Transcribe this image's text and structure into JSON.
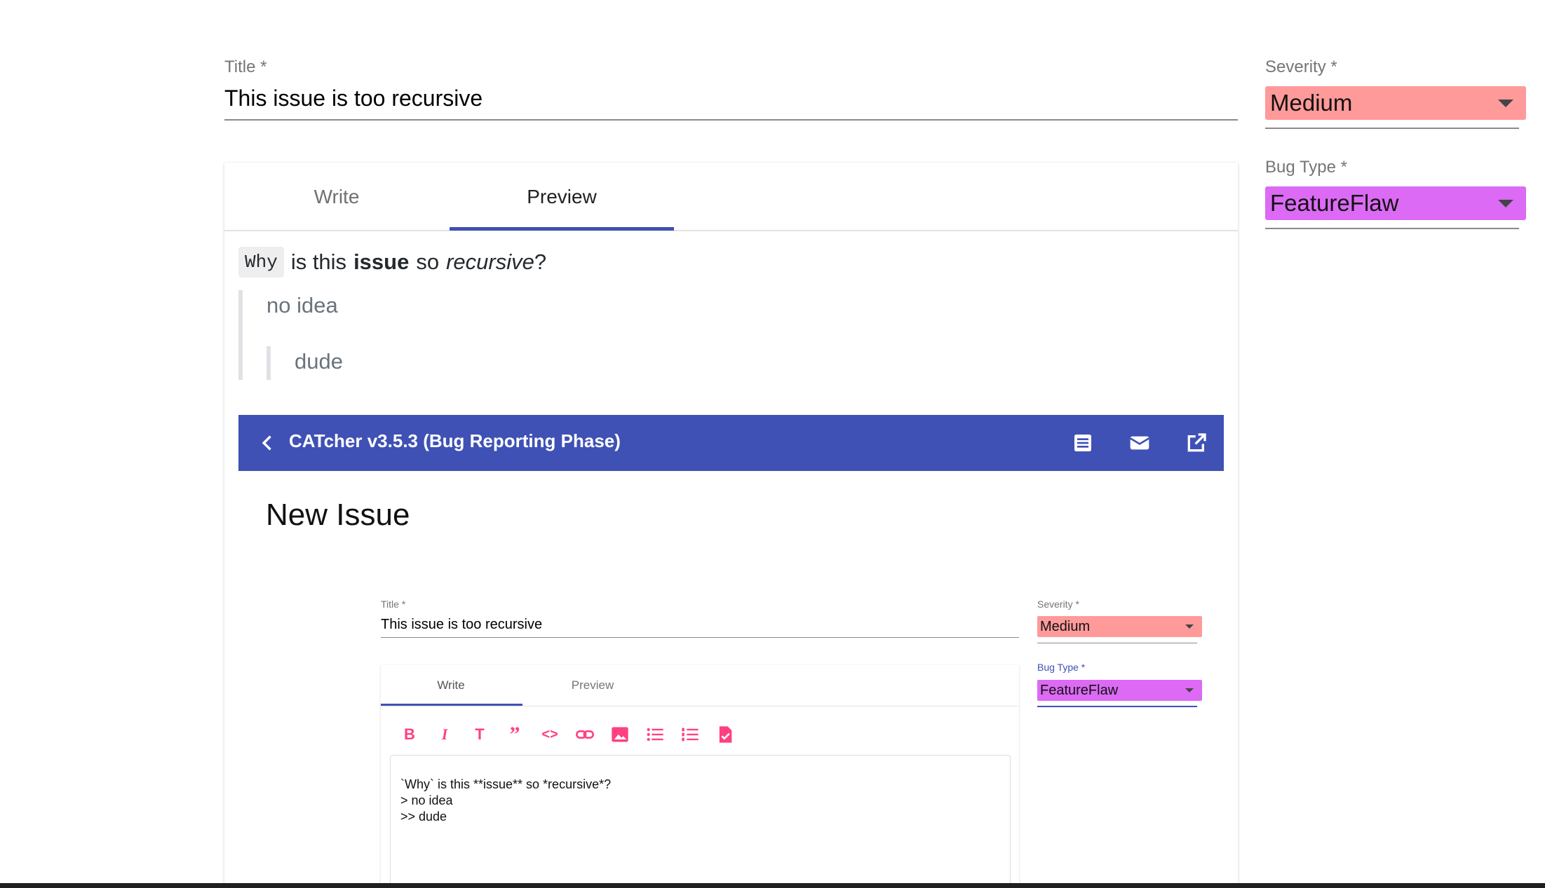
{
  "form": {
    "title_label": "Title *",
    "title_value": "This issue is too recursive",
    "severity_label": "Severity *",
    "severity_value": "Medium",
    "bugtype_label": "Bug Type *",
    "bugtype_value": "FeatureFlaw"
  },
  "tabs": {
    "write": "Write",
    "preview": "Preview",
    "active": "Preview"
  },
  "preview": {
    "code": "Why",
    "t1": "is this",
    "bold": "issue",
    "t2": "so",
    "italic": "recursive",
    "t3": "?",
    "quote1": "no idea",
    "quote2": "dude"
  },
  "nested": {
    "app_title": "CATcher v3.5.3  (Bug Reporting Phase)",
    "icons": [
      "back-icon",
      "document-icon",
      "mail-icon",
      "open-in-new-icon"
    ],
    "page_title": "New Issue",
    "title_label": "Title *",
    "title_value": "This issue is too recursive",
    "severity_label": "Severity *",
    "severity_value": "Medium",
    "bugtype_label": "Bug Type *",
    "bugtype_value": "FeatureFlaw",
    "tab_write": "Write",
    "tab_preview": "Preview",
    "toolbar": [
      "bold-icon",
      "italic-icon",
      "heading-icon",
      "quote-icon",
      "code-icon",
      "link-icon",
      "image-icon",
      "bullet-list-icon",
      "numbered-list-icon",
      "task-list-icon"
    ],
    "editor_line1": "`Why` is this **issue** so *recursive*?",
    "editor_line2": "> no idea",
    "editor_line3": ">> dude"
  },
  "colors": {
    "severity": "#ff9a9a",
    "bugtype": "#dc6af5",
    "primary": "#3f51b5",
    "accent": "#ff4081"
  }
}
